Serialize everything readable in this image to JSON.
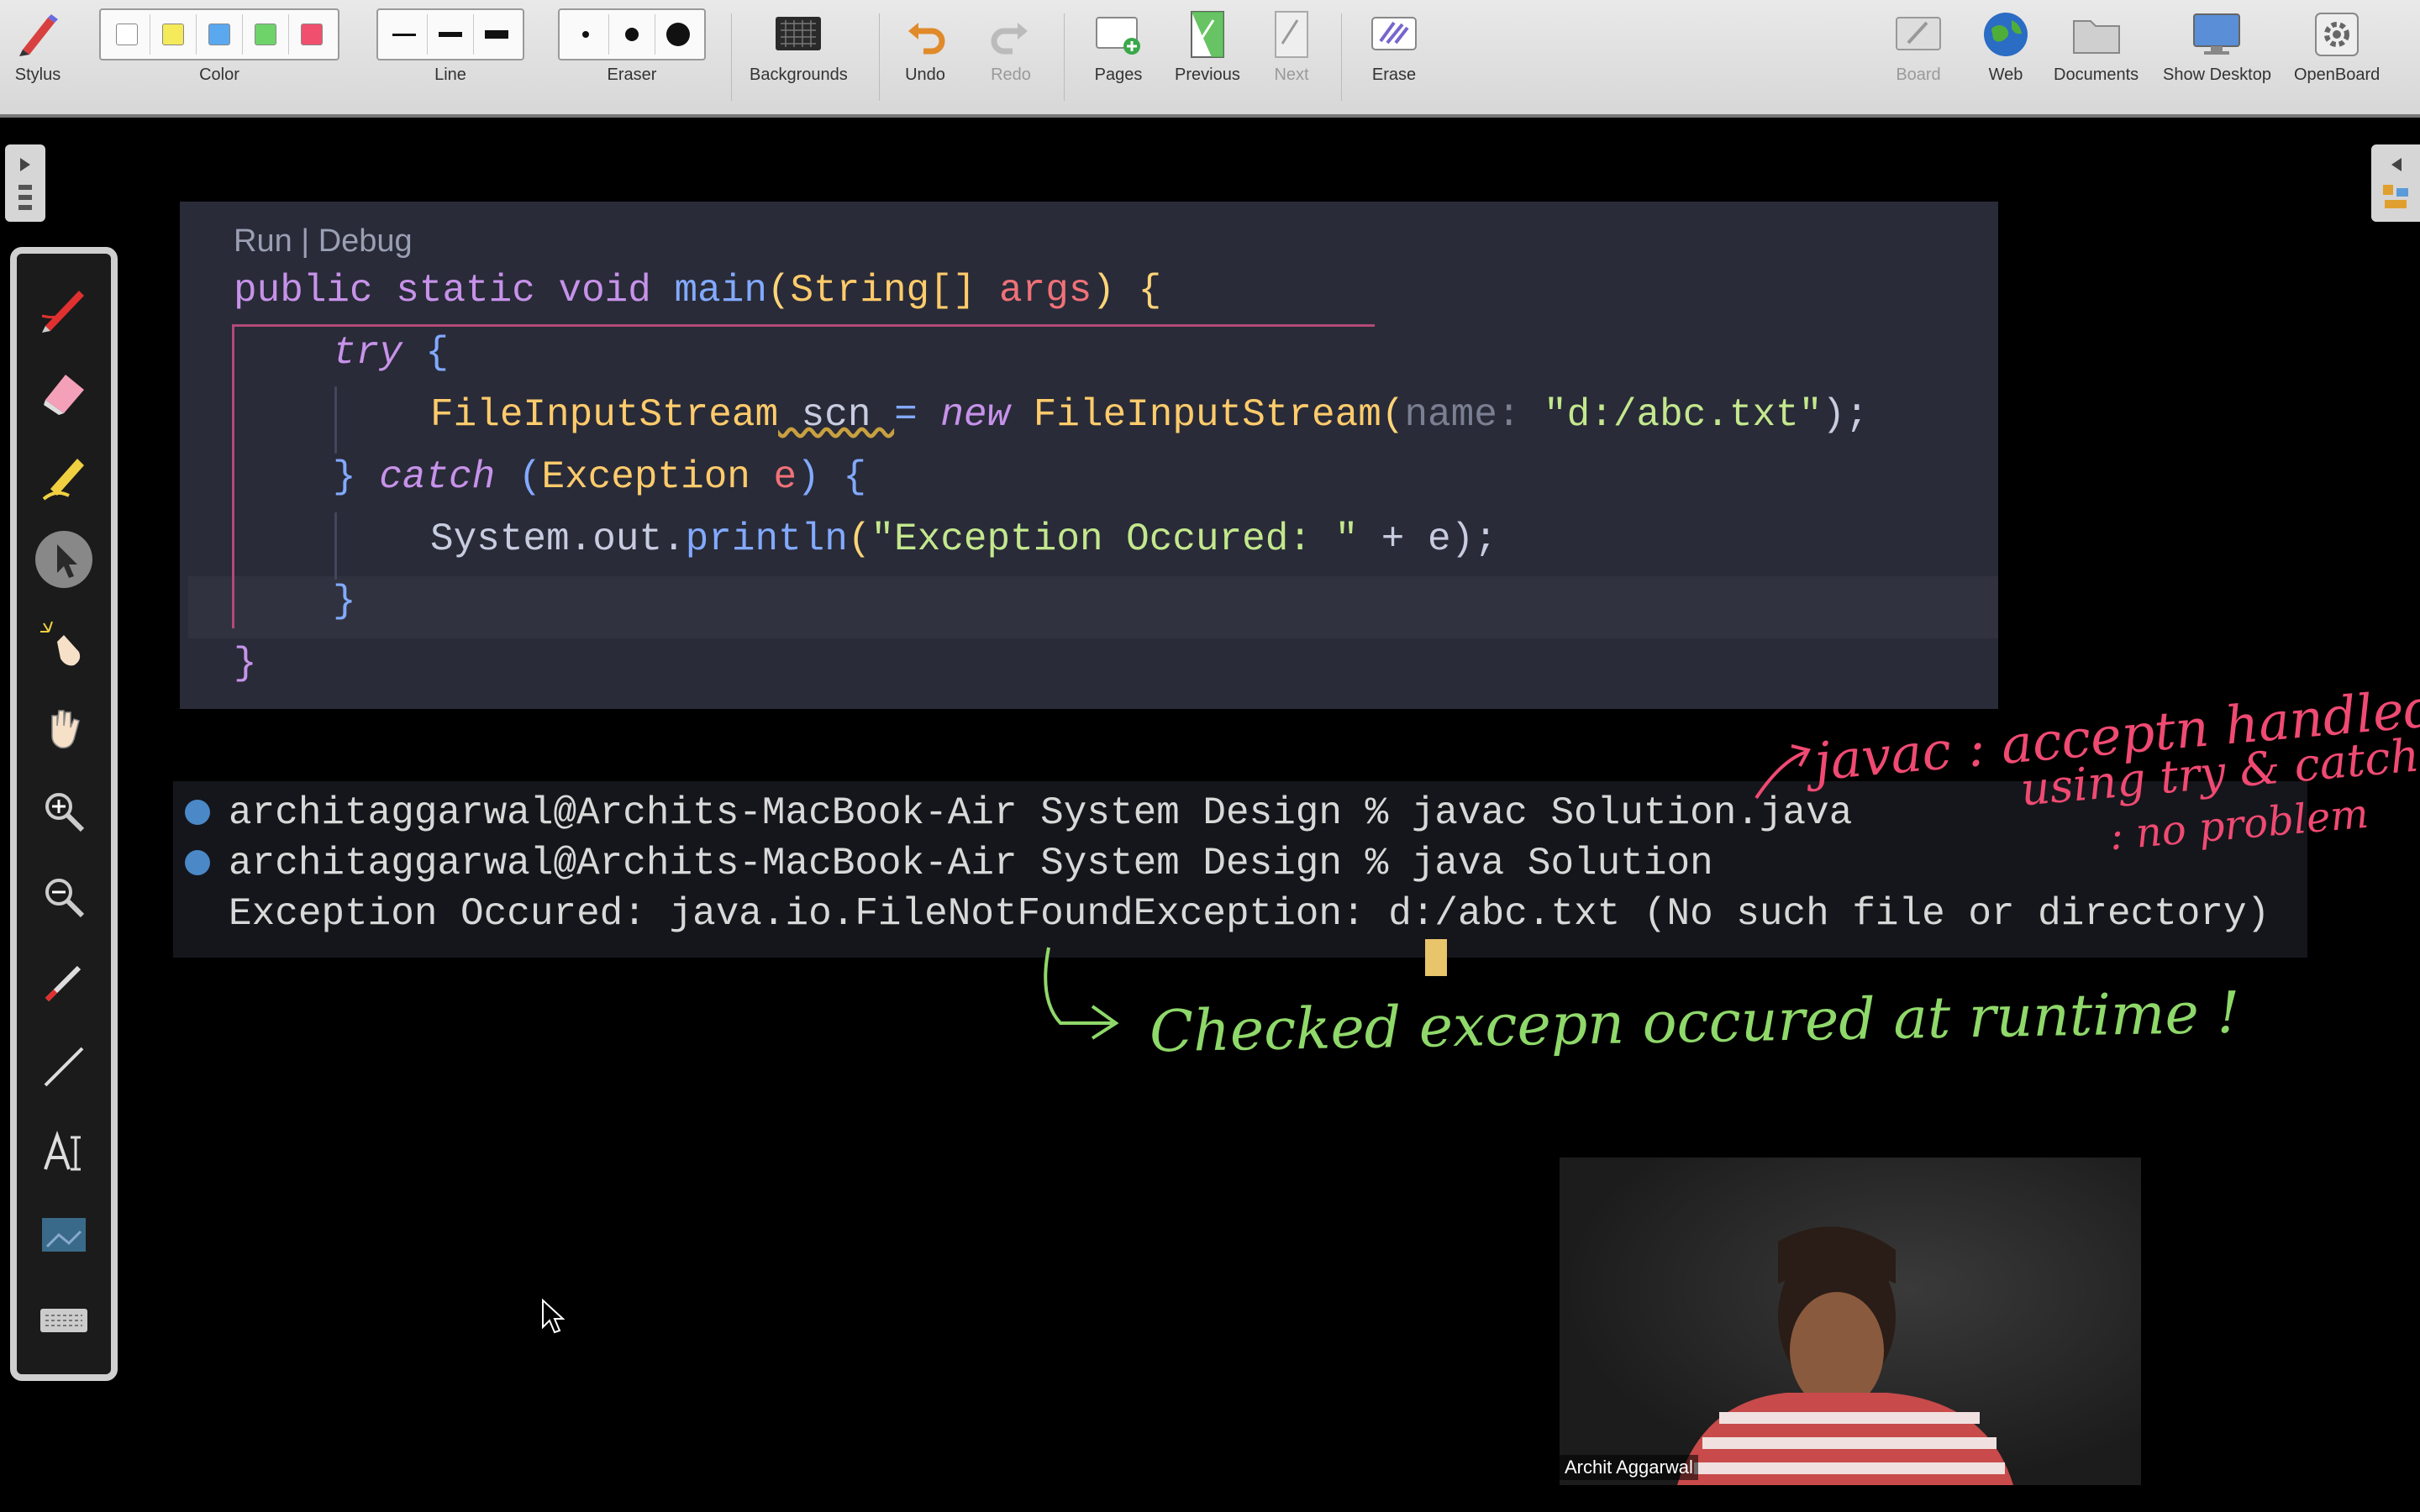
{
  "toolbar": {
    "stylus": "Stylus",
    "color": "Color",
    "colors": [
      "#ffffff",
      "#f4ea5a",
      "#5aa8f0",
      "#6ed46a",
      "#f0506e"
    ],
    "line": "Line",
    "eraser": "Eraser",
    "backgrounds": "Backgrounds",
    "undo": "Undo",
    "redo": "Redo",
    "pages": "Pages",
    "previous": "Previous",
    "next": "Next",
    "erase": "Erase",
    "board": "Board",
    "web": "Web",
    "documents": "Documents",
    "show_desktop": "Show Desktop",
    "openboard": "OpenBoard"
  },
  "editor": {
    "codelens": "Run | Debug",
    "l1": {
      "a": "public static void ",
      "b": "main",
      "c": "(",
      "d": "String[]",
      "e": " args",
      "f": ") {"
    },
    "l2": {
      "a": "try",
      "b": " {"
    },
    "l3": {
      "a": "FileInputStream",
      "b": " scn ",
      "c": "= ",
      "d": "new ",
      "e": "FileInputStream",
      "f": "(",
      "g": "name: ",
      "h": "\"d:/abc.txt\"",
      "i": ");"
    },
    "l4": {
      "a": "} ",
      "b": "catch",
      "c": " (",
      "d": "Exception",
      "e": " e",
      "f": ") {"
    },
    "l5": {
      "a": "System.out.",
      "b": "println",
      "c": "(",
      "d": "\"Exception Occured: \"",
      "e": " + e);"
    },
    "l6": "}",
    "l7": "}"
  },
  "terminal": {
    "line1": "architaggarwal@Archits-MacBook-Air System Design % javac Solution.java",
    "line2": "architaggarwal@Archits-MacBook-Air System Design % java Solution",
    "line3": "Exception Occured: java.io.FileNotFoundException: d:/abc.txt (No such file or directory)"
  },
  "annotations": {
    "red1": "javac : acceptn handled",
    "red2": "using try & catch",
    "red3": ": no problem",
    "green": "Checked  excepn  occured  at  runtime !"
  },
  "webcam": {
    "name": "Archit Aggarwal"
  }
}
